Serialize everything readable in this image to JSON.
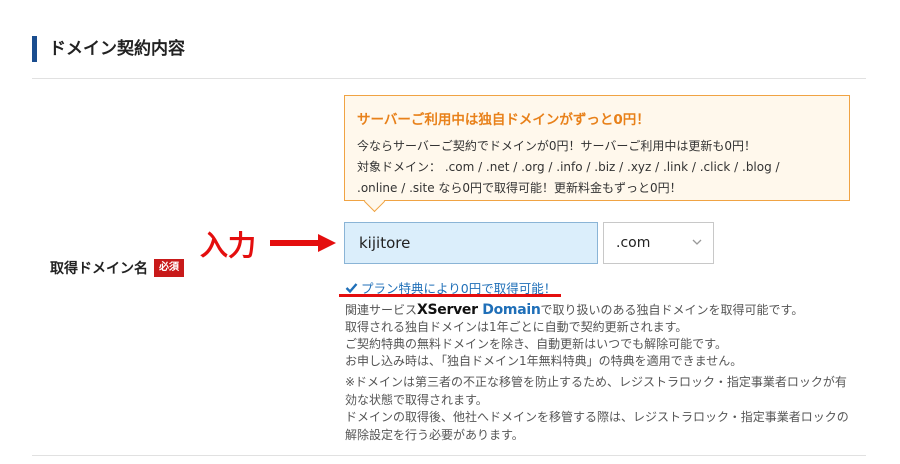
{
  "section": {
    "title": "ドメイン契約内容"
  },
  "callout": {
    "title": "サーバーご利用中は独自ドメインがずっと0円！",
    "line1": "今ならサーバーご契約でドメインが0円！サーバーご利用中は更新も0円！",
    "line2": "対象ドメイン： .com / .net / .org / .info / .biz / .xyz / .link / .click / .blog /",
    "line3": ".online / .site なら0円で取得可能！更新料金もずっと0円！"
  },
  "annotation": {
    "label": "入力"
  },
  "field": {
    "label": "取得ドメイン名",
    "required": "必須",
    "value": "kijitore",
    "tld_selected": ".com"
  },
  "benefit": {
    "text": "プラン特典により0円で取得可能！"
  },
  "notes": {
    "related_prefix": "関連サービス",
    "logo_x": "XServer",
    "logo_domain": "Domain",
    "related_suffix": "で取り扱いのある独自ドメインを取得可能です。",
    "line2": "取得される独自ドメインは1年ごとに自動で契約更新されます。",
    "line3": "ご契約特典の無料ドメインを除き、自動更新はいつでも解除可能です。",
    "line4": "お申し込み時は、「独自ドメイン1年無料特典」の特典を適用できません。",
    "line5": "※ドメインは第三者の不正な移管を防止するため、レジストラロック・指定事業者ロックが有",
    "line6": "効な状態で取得されます。",
    "line7": "ドメインの取得後、他社へドメインを移管する際は、レジストラロック・指定事業者ロックの",
    "line8": "解除設定を行う必要があります。"
  },
  "colors": {
    "accent_blue": "#1a4d8f",
    "callout_orange": "#e8811a",
    "annotation_red": "#e40e0e",
    "input_bg": "#dbeefb",
    "link_blue": "#1f6fb8"
  },
  "icons": {
    "check": "check-icon",
    "chevron": "chevron-down-icon",
    "arrow": "arrow-right-icon"
  }
}
